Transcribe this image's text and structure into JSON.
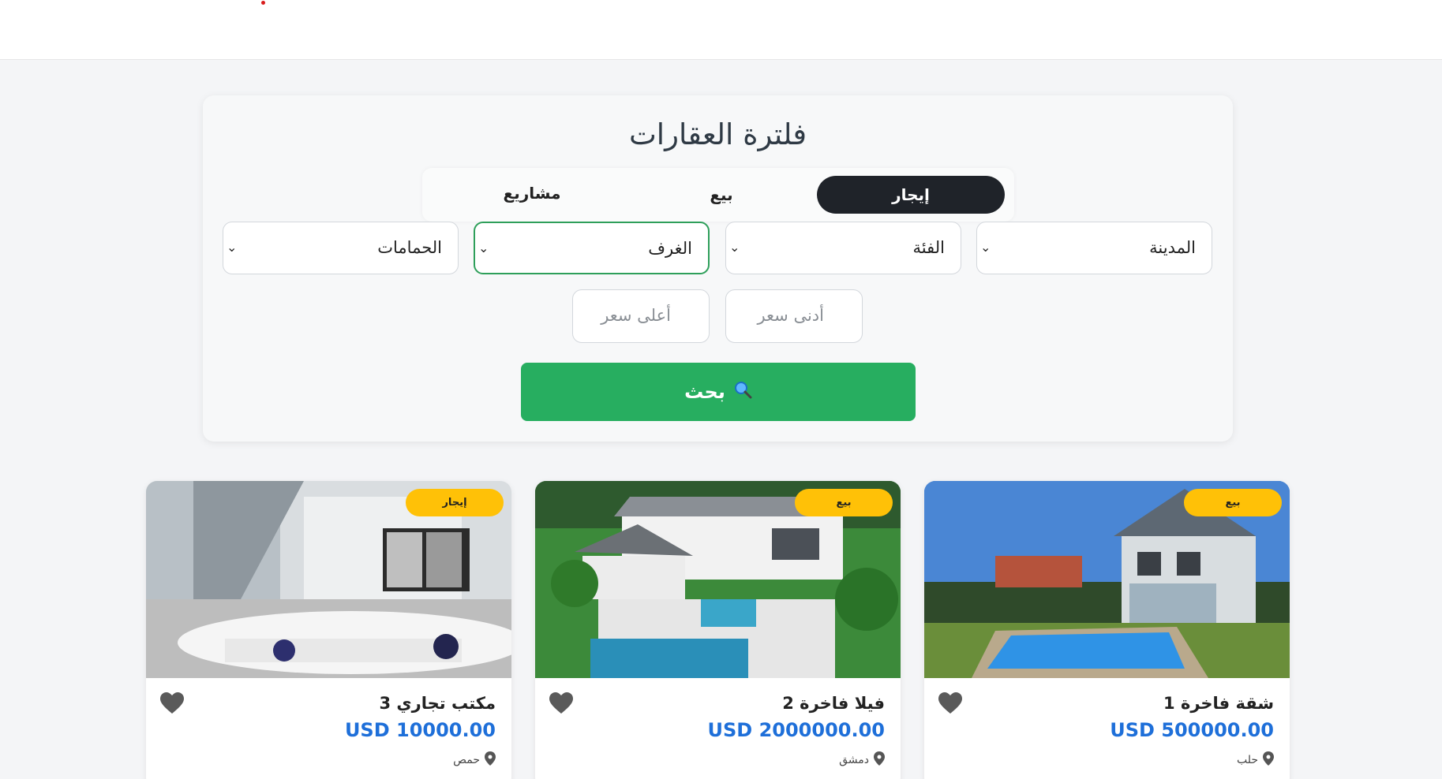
{
  "filter": {
    "title": "فلترة العقارات",
    "tabs": [
      {
        "label": "إيجار",
        "active": true
      },
      {
        "label": "بيع",
        "active": false
      },
      {
        "label": "مشاريع",
        "active": false
      }
    ],
    "selects": {
      "city": "المدينة",
      "category": "الفئة",
      "rooms": "الغرف",
      "bathrooms": "الحمامات"
    },
    "chevron": "⌄",
    "min_price_placeholder": "أدنى سعر",
    "max_price_placeholder": "أعلى سعر",
    "search_label": "بحث",
    "search_icon": "magnifier-icon"
  },
  "colors": {
    "accent_green": "#27ae60",
    "badge_yellow": "#ffc107",
    "price_blue": "#1e6fd9",
    "active_tab": "#1f2329"
  },
  "listings": [
    {
      "badge": "بيع",
      "title": "شقة فاخرة 1",
      "price": "USD 500000.00",
      "location": "حلب"
    },
    {
      "badge": "بيع",
      "title": "فيلا فاخرة 2",
      "price": "USD 2000000.00",
      "location": "دمشق"
    },
    {
      "badge": "إيجار",
      "title": "مكتب تجاري 3",
      "price": "USD 10000.00",
      "location": "حمص"
    }
  ]
}
